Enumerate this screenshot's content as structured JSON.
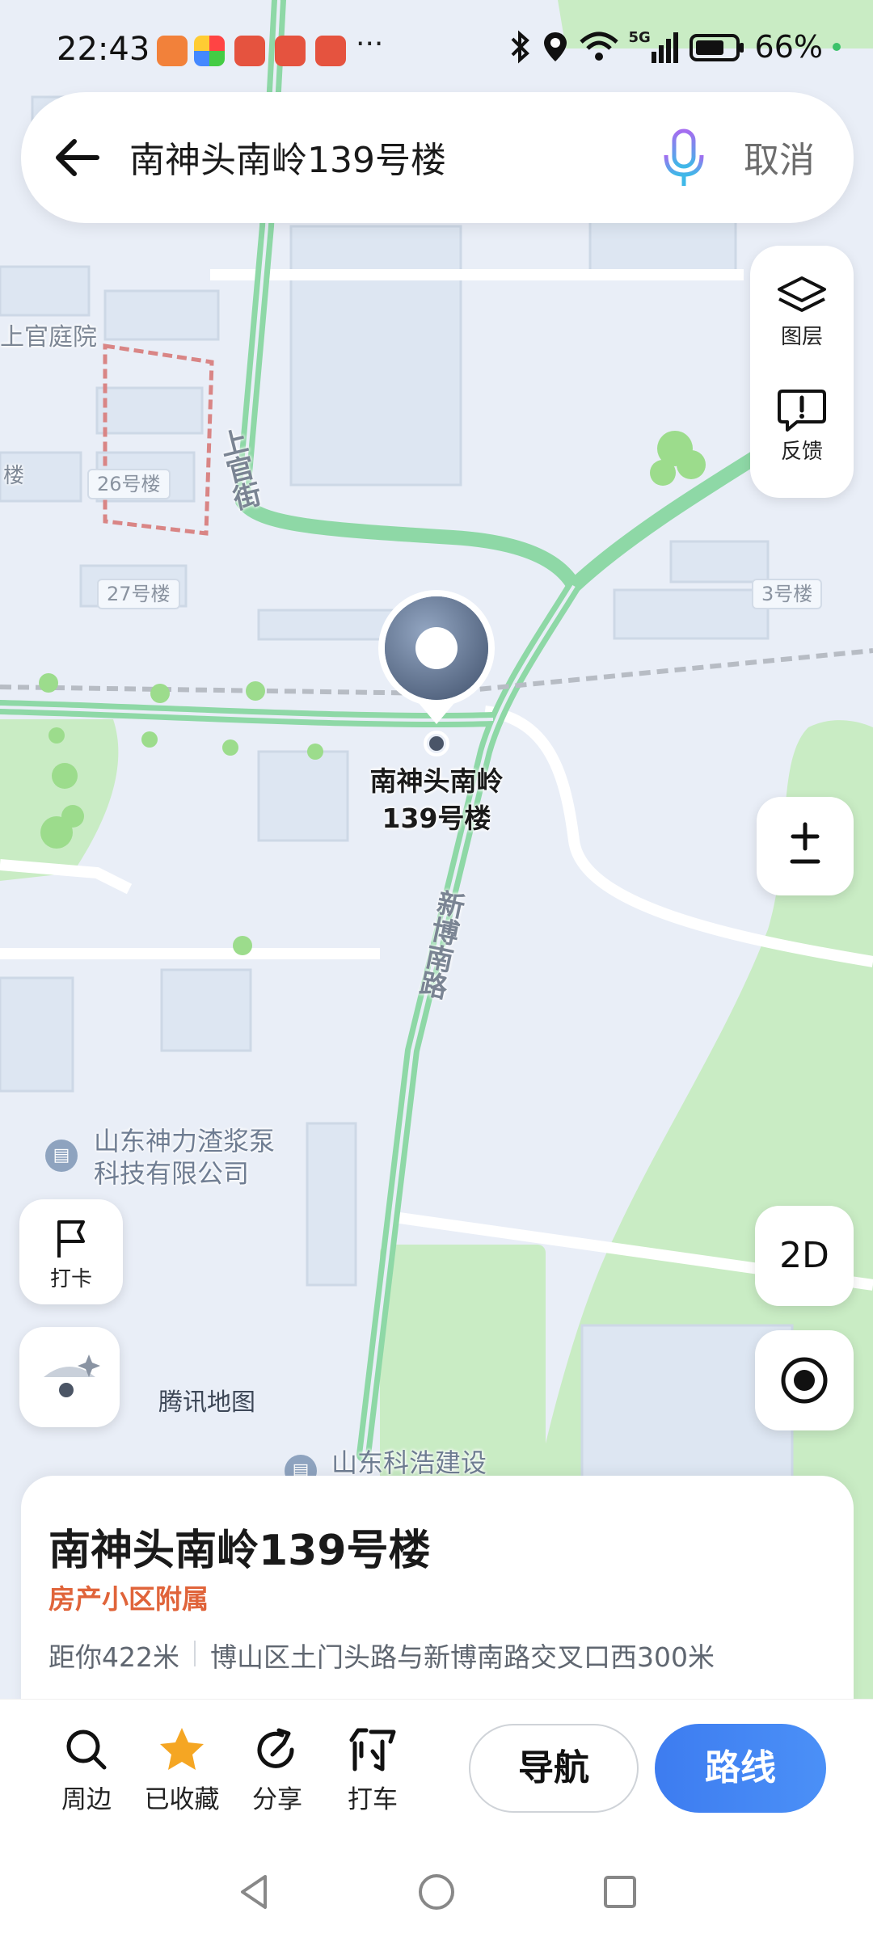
{
  "status_bar": {
    "time": "22:43",
    "overflow": "···",
    "battery_percent": "66%",
    "network": "5G",
    "notification_icons": [
      "app-orange-icon",
      "app-colorful-icon",
      "weibo-icon",
      "weibo-icon",
      "weibo-icon"
    ]
  },
  "search": {
    "query": "南神头南岭139号楼",
    "cancel_label": "取消"
  },
  "tools": {
    "layers_label": "图层",
    "feedback_label": "反馈"
  },
  "map": {
    "area_labels": {
      "courtyard": "上官庭院",
      "lou": "楼"
    },
    "building_labels": {
      "b26": "26号楼",
      "b27": "27号楼",
      "b3": "3号楼"
    },
    "road_labels": {
      "shangguan": "上官街",
      "xinbo": "新博南路"
    },
    "poi": {
      "company1": "山东神力渣浆泵科技有限公司",
      "company1_line1": "山东神力渣浆泵",
      "company1_line2": "科技有限公司",
      "company2": "山东科浩建设"
    },
    "place_name_line1": "南神头南岭",
    "place_name_line2": "139号楼",
    "watermark": "腾讯地图"
  },
  "controls": {
    "checkin_label": "打卡",
    "dimension_label": "2D"
  },
  "card": {
    "title": "南神头南岭139号楼",
    "category": "房产小区附属",
    "distance": "距你422米",
    "address": "博山区土门头路与新博南路交叉口西300米"
  },
  "actions": {
    "nearby": "周边",
    "favorited": "已收藏",
    "share": "分享",
    "taxi": "打车",
    "navigate": "导航",
    "route": "路线"
  },
  "colors": {
    "accent_blue": "#3d7cf0",
    "category_orange": "#e0643a",
    "road_green": "#8ed8a6",
    "favorite_star": "#f5a623"
  }
}
